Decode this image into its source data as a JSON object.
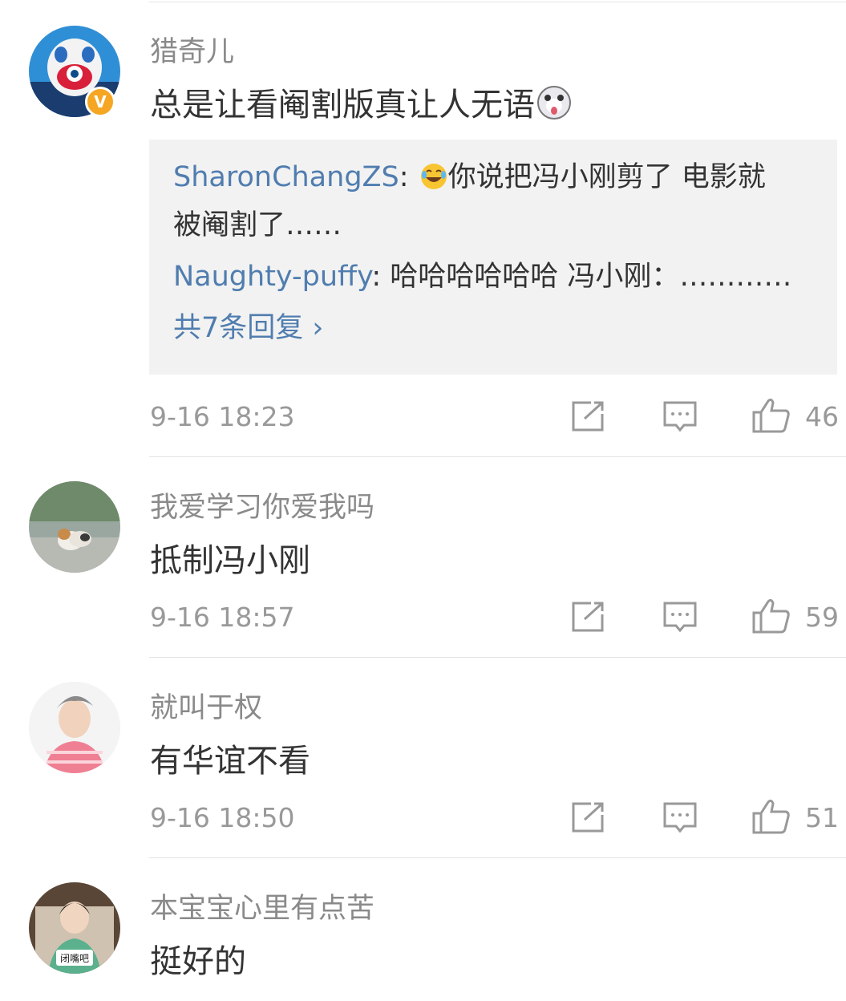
{
  "comments": [
    {
      "username": "猎奇儿",
      "text": "总是让看阉割版真让人无语",
      "verified": true,
      "emoji": "husky-emoji",
      "replies": [
        {
          "name": "SharonChangZS",
          "sep": ": ",
          "text_line1": "你说把冯小刚剪了 电影就",
          "text_line2": "被阉割了……",
          "emoji": "laughing-tears-emoji"
        },
        {
          "name": "Naughty-puffy",
          "sep": ": ",
          "text": "哈哈哈哈哈哈  冯小刚：…………"
        }
      ],
      "more_replies": "共7条回复 ›",
      "time": "9-16 18:23",
      "likes": "46"
    },
    {
      "username": "我爱学习你爱我吗",
      "text": "抵制冯小刚",
      "time": "9-16 18:57",
      "likes": "59"
    },
    {
      "username": "就叫于权",
      "text": "有华谊不看",
      "time": "9-16 18:50",
      "likes": "51"
    },
    {
      "username": "本宝宝心里有点苦",
      "text": "挺好的"
    }
  ],
  "avatar_badge_text": "闭嘴吧",
  "icons": {
    "share": "share-icon",
    "comment": "comment-icon",
    "like": "like-icon"
  },
  "colors": {
    "link": "#507daf",
    "badge": "#f5a623",
    "muted": "#999999",
    "text": "#333333"
  }
}
